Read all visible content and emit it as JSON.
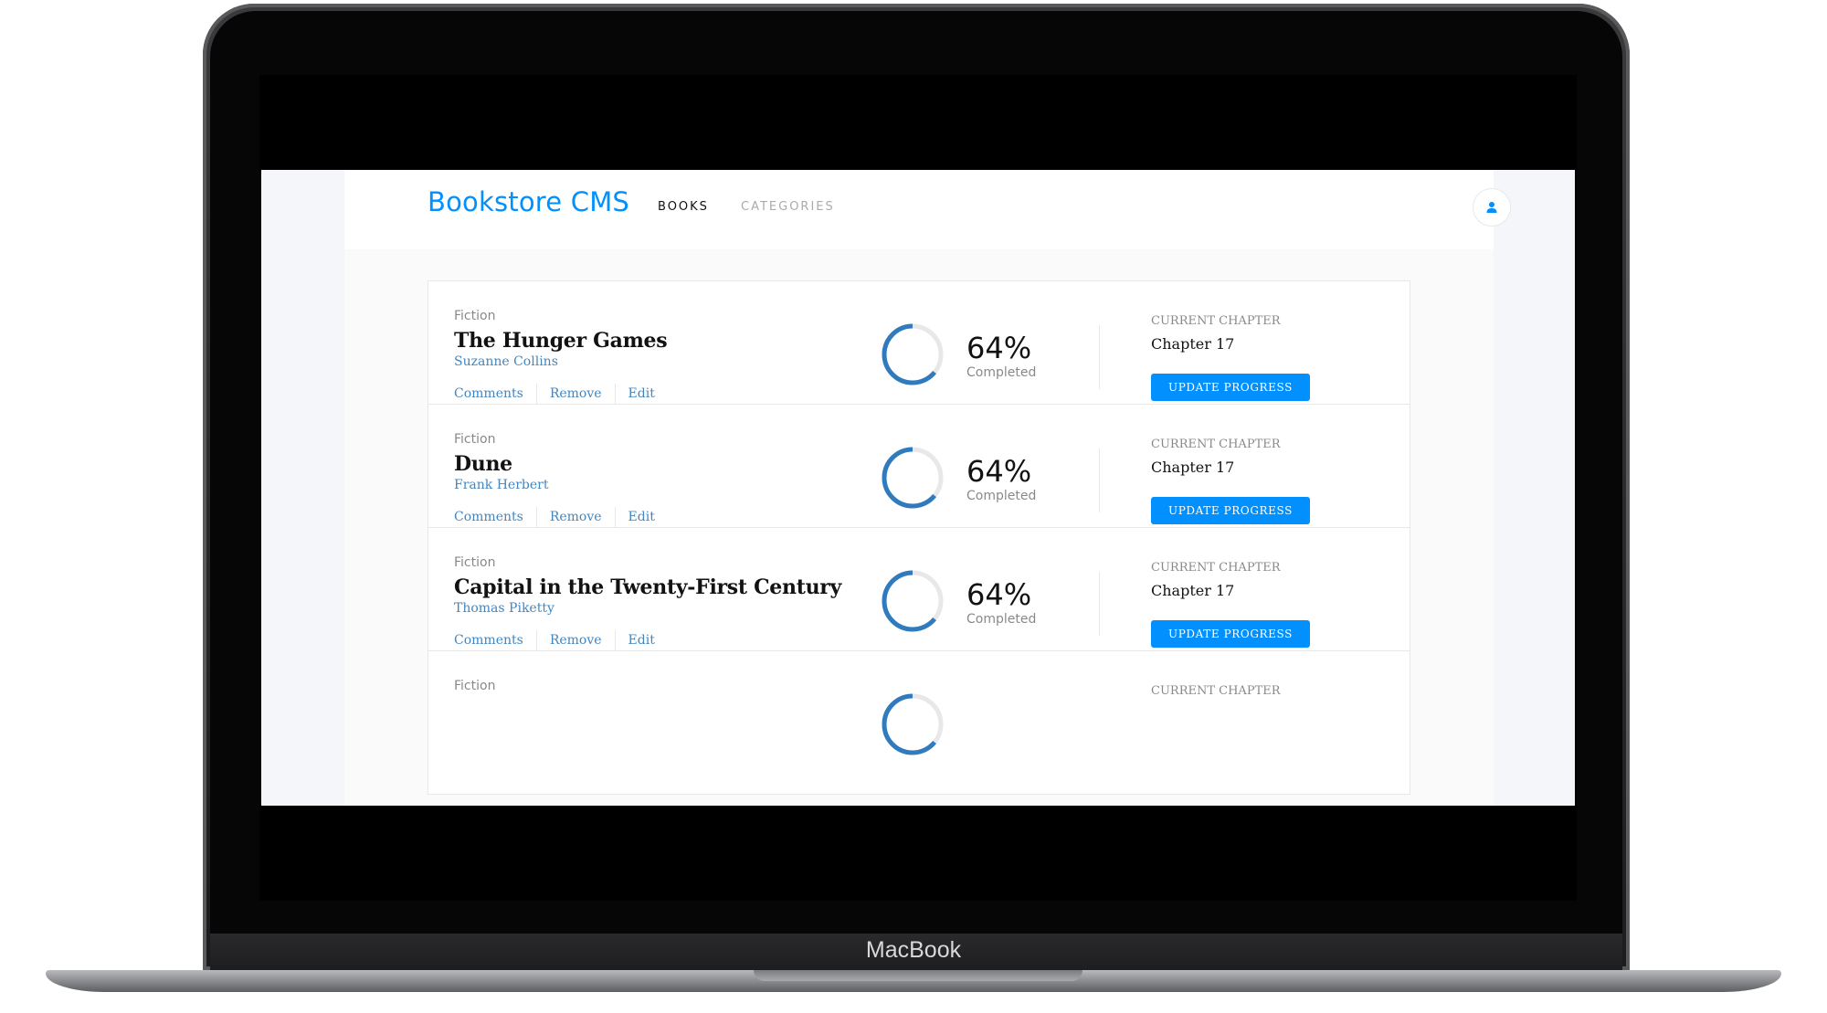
{
  "device": {
    "brand_label": "MacBook"
  },
  "app": {
    "logo": "Bookstore CMS",
    "nav": [
      {
        "label": "BOOKS",
        "active": true
      },
      {
        "label": "CATEGORIES",
        "active": false
      }
    ],
    "user_icon": "user-icon",
    "accent_color": "#0290ff",
    "link_color": "#4386bf"
  },
  "books": [
    {
      "genre": "Fiction",
      "title": "The Hunger Games",
      "author": "Suzanne Collins",
      "actions": [
        "Comments",
        "Remove",
        "Edit"
      ],
      "progress_label": "64%",
      "progress_fraction": 0.64,
      "progress_caption": "Completed",
      "current_chapter_label": "CURRENT CHAPTER",
      "current_chapter": "Chapter 17",
      "button_label": "UPDATE PROGRESS"
    },
    {
      "genre": "Fiction",
      "title": "Dune",
      "author": "Frank Herbert",
      "actions": [
        "Comments",
        "Remove",
        "Edit"
      ],
      "progress_label": "64%",
      "progress_fraction": 0.64,
      "progress_caption": "Completed",
      "current_chapter_label": "CURRENT CHAPTER",
      "current_chapter": "Chapter 17",
      "button_label": "UPDATE PROGRESS"
    },
    {
      "genre": "Fiction",
      "title": "Capital in the Twenty-First Century",
      "author": "Thomas Piketty",
      "actions": [
        "Comments",
        "Remove",
        "Edit"
      ],
      "progress_label": "64%",
      "progress_fraction": 0.64,
      "progress_caption": "Completed",
      "current_chapter_label": "CURRENT CHAPTER",
      "current_chapter": "Chapter 17",
      "button_label": "UPDATE PROGRESS"
    },
    {
      "genre": "Fiction",
      "current_chapter_label": "CURRENT CHAPTER",
      "progress_fraction": 0.64
    }
  ]
}
